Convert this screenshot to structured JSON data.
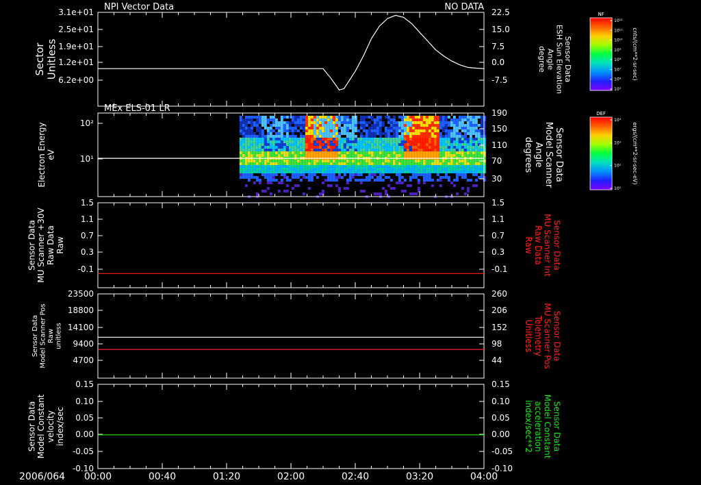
{
  "header": {
    "title": "NPI Vector Data",
    "status": "NO DATA"
  },
  "panel2_title": "MEx ELS-01 LR",
  "x_axis": {
    "start_label": "2006/064",
    "ticks": [
      "00:00",
      "00:40",
      "01:20",
      "02:00",
      "02:40",
      "03:20",
      "04:00"
    ]
  },
  "colorbar_nf": {
    "label": "NF",
    "unit": "cnts/(cm**2-sr-sec)",
    "ticks": [
      "10¹²",
      "10¹¹",
      "10¹⁰",
      "10⁹",
      "10⁸",
      "10⁷",
      "10⁶",
      "10⁵"
    ]
  },
  "colorbar_def": {
    "label": "DEF",
    "unit": "ergs/(cm**2-sr-sec-eV)",
    "ticks": [
      "10⁴",
      "10³",
      "10²",
      "10¹"
    ]
  },
  "panels": [
    {
      "left_label": [
        "Sector",
        "Unitless"
      ],
      "left_ticks": [
        "3.1e+01",
        "2.5e+01",
        "1.9e+01",
        "1.2e+01",
        "6.2e+00"
      ],
      "right_label": [
        "Sensor Data",
        "ESH Sun Elevation",
        "Angle",
        "degree"
      ],
      "right_ticks": [
        "22.5",
        "15.0",
        "7.5",
        "0.0",
        "-7.5"
      ],
      "right_color": "#ffffff"
    },
    {
      "left_label": [
        "Electron Energy",
        "eV"
      ],
      "left_ticks": [
        "10²",
        "10¹"
      ],
      "right_label": [
        "Sensor Data",
        "Model Scanner",
        "Angle",
        "degrees"
      ],
      "right_ticks": [
        "190",
        "150",
        "110",
        "70",
        "30"
      ],
      "right_color": "#ffffff"
    },
    {
      "left_label": [
        "Sensor Data",
        "MU Scanner +30V",
        "Raw Data",
        "Raw"
      ],
      "left_ticks": [
        "1.5",
        "1.1",
        "0.7",
        "0.3",
        "-0.1"
      ],
      "right_label": [
        "Sensor Data",
        "MU Scanner Int",
        "Raw Data",
        "Raw"
      ],
      "right_ticks": [
        "1.5",
        "1.1",
        "0.7",
        "0.3",
        "-0.1"
      ],
      "right_color": "#ff2020"
    },
    {
      "left_label": [
        "Sensor Data",
        "Model Scanner Pos",
        "Raw",
        "unitless"
      ],
      "left_ticks": [
        "23500",
        "18800",
        "14100",
        "9400",
        "4700"
      ],
      "right_label": [
        "Sensor Data",
        "MU Scanner Pos",
        "Telemetry",
        "Unitless"
      ],
      "right_ticks": [
        "260",
        "206",
        "152",
        "98",
        "44"
      ],
      "right_color": "#ff2020"
    },
    {
      "left_label": [
        "Sensor Data",
        "Model Constant",
        "velocity",
        "index/sec"
      ],
      "left_ticks": [
        "0.15",
        "0.10",
        "0.05",
        "0.00",
        "-0.05",
        "-0.10"
      ],
      "right_label": [
        "Sensor Data",
        "Model Constant",
        "acceleration",
        "index/sec**2"
      ],
      "right_ticks": [
        "0.15",
        "0.10",
        "0.05",
        "0.00",
        "-0.05",
        "-0.10"
      ],
      "right_color": "#20e020"
    }
  ],
  "chart_data": [
    {
      "type": "line",
      "panel": 1,
      "x_range_min": [
        0,
        240
      ],
      "ylim_left": [
        0,
        31
      ],
      "ylim_right": [
        -15,
        22.5
      ],
      "series": [
        {
          "color": "#ffffff",
          "axis": "right",
          "x": [
            0,
            140,
            145,
            150,
            153,
            156,
            160,
            165,
            170,
            175,
            180,
            185,
            190,
            195,
            200,
            205,
            210,
            215,
            220,
            225,
            230,
            235,
            240
          ],
          "y": [
            0,
            0,
            -4,
            -8.5,
            -8,
            -5,
            -1,
            5,
            12,
            17,
            20,
            21.3,
            20.5,
            18,
            14.5,
            11,
            7.5,
            5,
            3,
            1.5,
            0.5,
            0.2,
            0
          ]
        }
      ]
    },
    {
      "type": "heatmap",
      "panel": 2,
      "x_range_min": [
        0,
        240
      ],
      "ylim_right": [
        0,
        190
      ],
      "data_start_min": 88,
      "hot_regions_min": [
        [
          128,
          148
        ],
        [
          190,
          212
        ]
      ],
      "series": [
        {
          "color": "#ffffff",
          "axis": "right",
          "x": [
            0,
            240
          ],
          "y": [
            87,
            87
          ]
        }
      ]
    },
    {
      "type": "line",
      "panel": 3,
      "x_range_min": [
        0,
        240
      ],
      "ylim": [
        -0.3,
        1.5
      ],
      "series": [
        {
          "color": "#ff2020",
          "axis": "left",
          "x": [
            0,
            240
          ],
          "y": [
            0,
            0
          ]
        }
      ]
    },
    {
      "type": "line",
      "panel": 4,
      "x_range_min": [
        0,
        240
      ],
      "ylim_left": [
        0,
        23500
      ],
      "ylim_right": [
        0,
        260
      ],
      "series": [
        {
          "color": "#ffffff",
          "axis": "left",
          "x": [
            0,
            240
          ],
          "y": [
            11400,
            11400
          ]
        },
        {
          "color": "#ff2020",
          "axis": "left",
          "x": [
            0,
            240
          ],
          "y": [
            8000,
            8000
          ]
        }
      ]
    },
    {
      "type": "line",
      "panel": 5,
      "x_range_min": [
        0,
        240
      ],
      "ylim": [
        -0.1,
        0.15
      ],
      "series": [
        {
          "color": "#20e020",
          "axis": "left",
          "x": [
            0,
            240
          ],
          "y": [
            0,
            0
          ]
        }
      ]
    }
  ]
}
